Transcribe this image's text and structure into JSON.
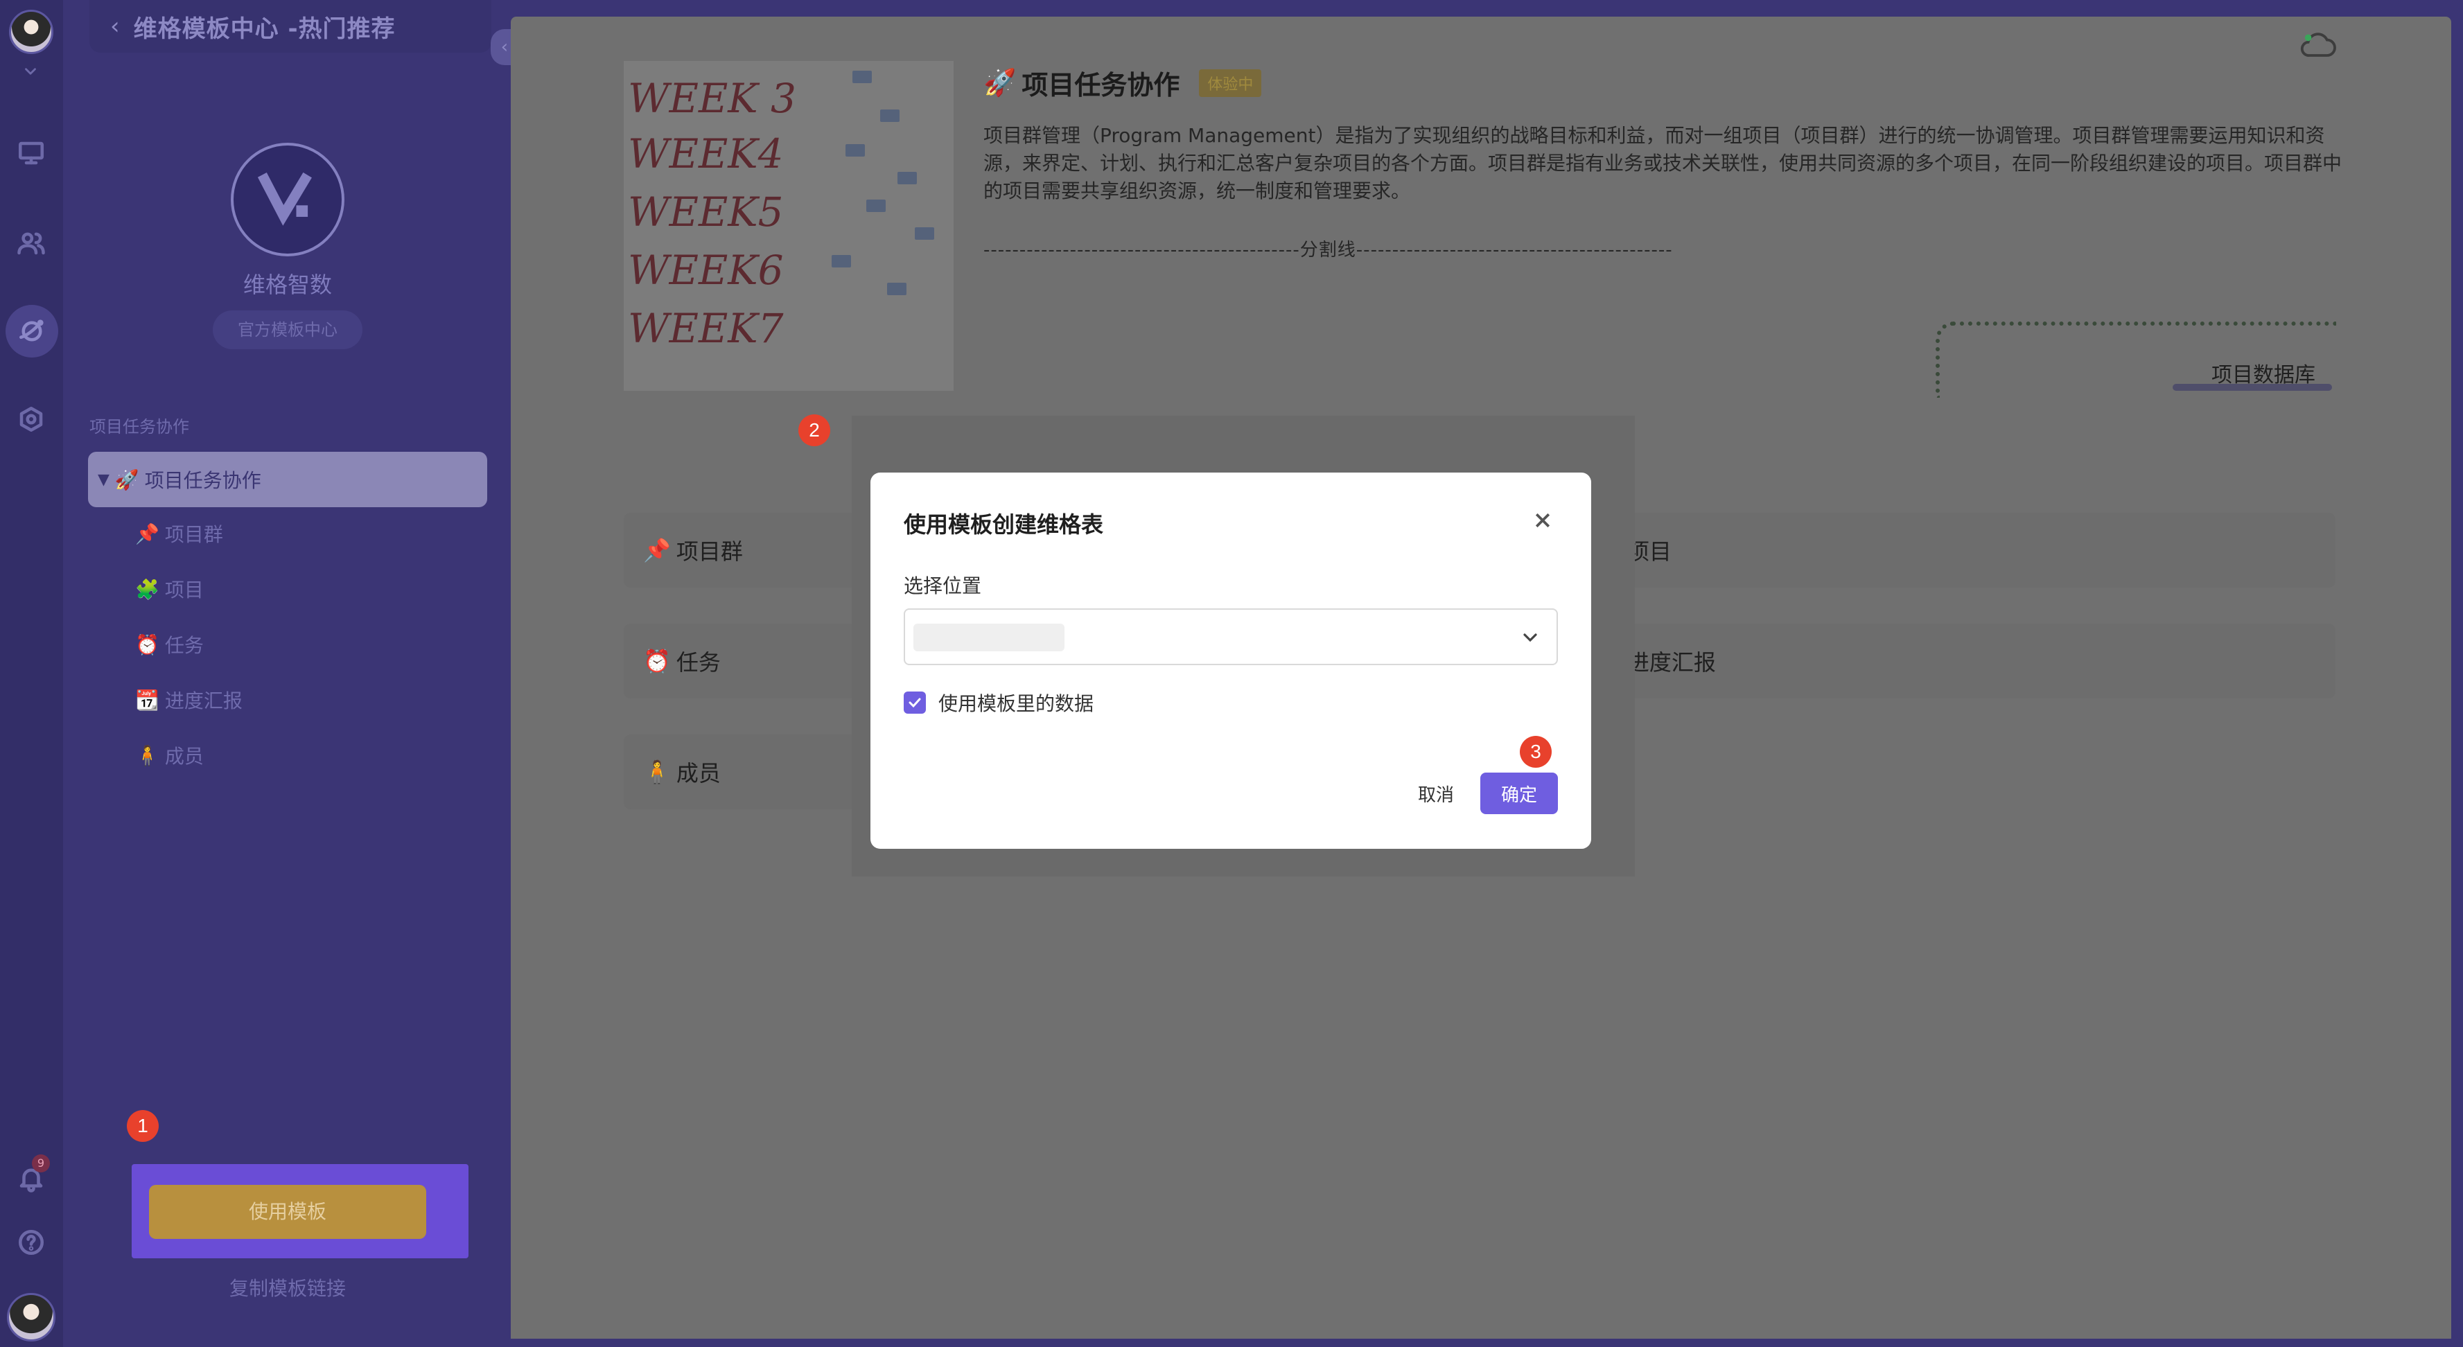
{
  "sidebar": {
    "header_title": "维格模板中心 -热门推荐",
    "brand_name": "维格智数",
    "brand_tag": "官方模板中心",
    "section_label": "项目任务协作",
    "tree_root": {
      "emoji": "🚀",
      "label": "项目任务协作"
    },
    "tree_items": [
      {
        "emoji": "📌",
        "label": "项目群"
      },
      {
        "emoji": "🧩",
        "label": "项目"
      },
      {
        "emoji": "⏰",
        "label": "任务"
      },
      {
        "emoji": "📆",
        "label": "进度汇报"
      },
      {
        "emoji": "🧍",
        "label": "成员"
      }
    ],
    "use_template_label": "使用模板",
    "copy_link_label": "复制模板链接"
  },
  "rail": {
    "notification_count": "9"
  },
  "template": {
    "title_emoji": "🚀",
    "title": "项目任务协作",
    "badge": "体验中",
    "description": "项目群管理（Program Management）是指为了实现组织的战略目标和利益，而对一组项目（项目群）进行的统一协调管理。项目群管理需要运用知识和资源，来界定、计划、执行和汇总客户复杂项目的各个方面。项目群是指有业务或技术关联性，使用共同资源的多个项目，在同一阶段组织建设的项目。项目群中的项目需要共享组织资源，统一制度和管理要求。",
    "divider": "--------------------------------------------分割线--------------------------------------------",
    "database_tab": "项目数据库",
    "cover_words": [
      "WEEK 3",
      "WEEK4",
      "WEEK5",
      "WEEK6",
      "WEEK7"
    ],
    "tables": [
      {
        "emoji": "📌",
        "label": "项目群"
      },
      {
        "emoji": "🧩",
        "label": "项目"
      },
      {
        "emoji": "⏰",
        "label": "任务"
      },
      {
        "emoji": "📆",
        "label": "进度汇报"
      },
      {
        "emoji": "🧍",
        "label": "成员"
      }
    ]
  },
  "dialog": {
    "title": "使用模板创建维格表",
    "location_label": "选择位置",
    "use_data_label": "使用模板里的数据",
    "use_data_checked": true,
    "cancel_label": "取消",
    "ok_label": "确定"
  },
  "steps": [
    "1",
    "2",
    "3"
  ],
  "colors": {
    "accent": "#6f5ee0",
    "step_marker": "#e8412c",
    "use_button": "#b8903e",
    "sidebar_bg": "#3b3575"
  }
}
